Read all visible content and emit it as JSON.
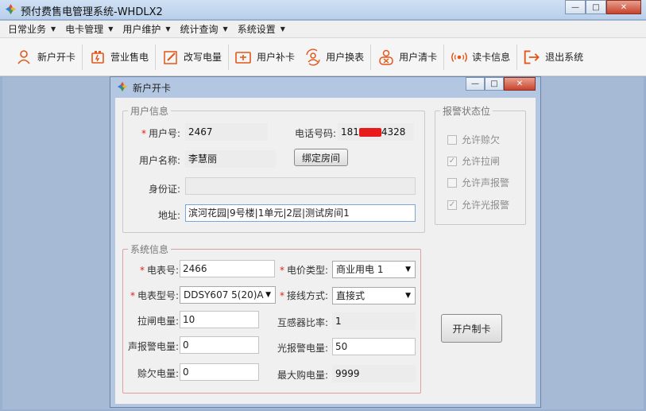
{
  "app": {
    "title": "预付费售电管理系统-WHDLX2",
    "window_controls": {
      "minimize": "—",
      "maximize": "□",
      "close": "✕"
    }
  },
  "menubar": [
    {
      "label": "日常业务"
    },
    {
      "label": "电卡管理"
    },
    {
      "label": "用户维护"
    },
    {
      "label": "统计查询"
    },
    {
      "label": "系统设置"
    }
  ],
  "toolbar": [
    {
      "label": "新户开卡",
      "icon": "user-add-icon"
    },
    {
      "label": "营业售电",
      "icon": "battery-icon"
    },
    {
      "label": "改写电量",
      "icon": "edit-icon"
    },
    {
      "label": "用户补卡",
      "icon": "card-add-icon"
    },
    {
      "label": "用户换表",
      "icon": "swap-user-icon"
    },
    {
      "label": "用户清卡",
      "icon": "user-clear-icon"
    },
    {
      "label": "读卡信息",
      "icon": "rfid-icon"
    },
    {
      "label": "退出系统",
      "icon": "exit-icon"
    }
  ],
  "dialog": {
    "title": "新户开卡",
    "user_info": {
      "legend": "用户信息",
      "user_no_label": "用户号:",
      "user_no": "2467",
      "phone_label": "电话号码:",
      "phone_prefix": "181",
      "phone_suffix": "4328",
      "name_label": "用户名称:",
      "name": "李慧丽",
      "bind_room_button": "绑定房间",
      "id_label": "身份证:",
      "id_value": "",
      "address_label": "地址:",
      "address": "滨河花园|9号楼|1单元|2层|测试房间1"
    },
    "alarm": {
      "legend": "报警状态位",
      "options": [
        {
          "label": "允许赊欠",
          "checked": false
        },
        {
          "label": "允许拉闸",
          "checked": true
        },
        {
          "label": "允许声报警",
          "checked": false
        },
        {
          "label": "允许光报警",
          "checked": true
        }
      ]
    },
    "system_info": {
      "legend": "系统信息",
      "meter_no_label": "电表号:",
      "meter_no": "2466",
      "price_type_label": "电价类型:",
      "price_type": "商业用电 1",
      "meter_model_label": "电表型号:",
      "meter_model": "DDSY607 5(20)A",
      "wiring_label": "接线方式:",
      "wiring": "直接式",
      "trip_label": "拉闸电量:",
      "trip": "10",
      "ct_ratio_label": "互感器比率:",
      "ct_ratio": "1",
      "sound_alarm_label": "声报警电量:",
      "sound_alarm": "0",
      "light_alarm_label": "光报警电量:",
      "light_alarm": "50",
      "credit_label": "赊欠电量:",
      "credit": "0",
      "max_buy_label": "最大购电量:",
      "max_buy": "9999"
    },
    "open_card_button": "开户制卡"
  },
  "colors": {
    "required_star": "#e02020",
    "redaction": "#e81b1b",
    "exit_icon": "#e2571a"
  }
}
